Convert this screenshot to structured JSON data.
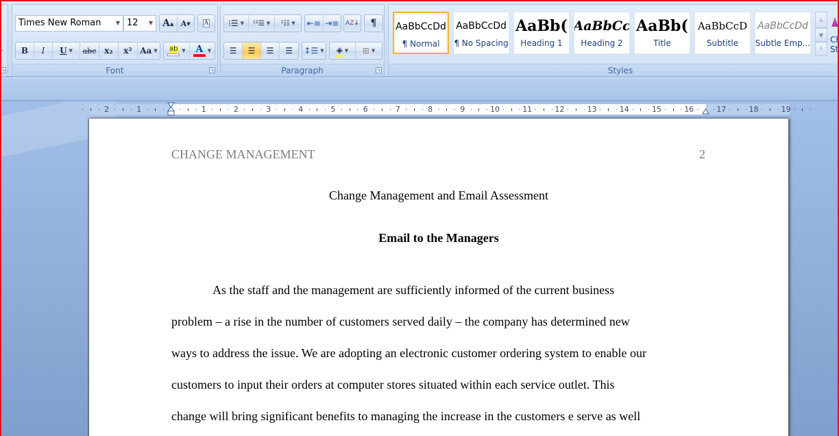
{
  "ribbon": {
    "font_group": {
      "label": "Font",
      "font_name": "Times New Roman",
      "font_size": "12",
      "buttons": {
        "grow": "A",
        "shrink": "A",
        "clear": "A",
        "bold": "B",
        "italic": "I",
        "underline": "U",
        "strike": "abc",
        "subscript": "x₂",
        "superscript": "x²",
        "change_case": "Aa",
        "highlight": "ab",
        "font_color": "A"
      },
      "font_color_value": "#e8101a",
      "highlight_color_value": "#ffff00"
    },
    "paragraph_group": {
      "label": "Paragraph",
      "active_alignment": "center",
      "pilcrow": "¶"
    },
    "styles_group": {
      "label": "Styles",
      "styles": [
        {
          "preview": "AaBbCcDd",
          "name": "¶ Normal",
          "selected": true
        },
        {
          "preview": "AaBbCcDd",
          "name": "¶ No Spacing",
          "selected": false
        },
        {
          "preview": "AaBb(",
          "name": "Heading 1",
          "selected": false
        },
        {
          "preview": "AaBbCc",
          "name": "Heading 2",
          "selected": false
        },
        {
          "preview": "AaBb(",
          "name": "Title",
          "selected": false
        },
        {
          "preview": "AaBbCcD",
          "name": "Subtitle",
          "selected": false
        },
        {
          "preview": "AaBbCcDd",
          "name": "Subtle Emp...",
          "selected": false
        }
      ],
      "change_styles_label_1": "Ch",
      "change_styles_label_2": "St"
    },
    "left_cut_label": "r"
  },
  "ruler": {
    "left_numbers": [
      "2",
      "1"
    ],
    "right_numbers": [
      "1",
      "2",
      "3",
      "4",
      "5",
      "6",
      "7",
      "8",
      "9",
      "10",
      "11",
      "12",
      "13",
      "14",
      "15",
      "16",
      "17",
      "18",
      "19"
    ]
  },
  "document": {
    "running_head": "CHANGE MANAGEMENT",
    "page_number": "2",
    "title": "Change Management and Email Assessment",
    "subtitle": "Email to the Managers",
    "paragraph_lines": [
      "As the staff and the management are sufficiently informed of the current business",
      "problem – a rise in the number of customers served daily – the company has determined new",
      "ways to address the issue. We are adopting an electronic customer ordering system to enable our",
      "customers to input their orders at computer stores situated within each service outlet. This",
      "change will bring significant benefits to managing the increase in the customers e serve as well"
    ]
  }
}
